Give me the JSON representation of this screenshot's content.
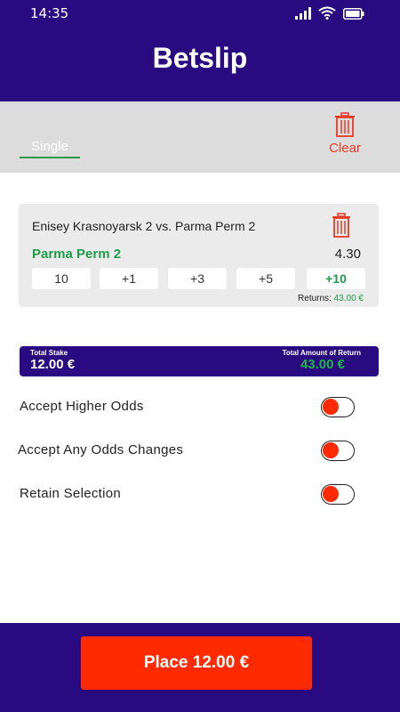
{
  "status_bar": {
    "time": "14:35",
    "icons": [
      "signal-icon",
      "wifi-icon",
      "battery-icon"
    ]
  },
  "header": {
    "title": "Betslip"
  },
  "tabs": {
    "single_label": "Single",
    "clear_label": "Clear"
  },
  "bet": {
    "match": "Enisey Krasnoyarsk 2 vs. Parma Perm 2",
    "selection": "Parma Perm 2",
    "odds": "4.30",
    "stake_buttons": [
      "10",
      "+1",
      "+3",
      "+5",
      "+10"
    ],
    "returns_label": "Returns:",
    "returns_value": "43.00 €"
  },
  "totals": {
    "stake_label": "Total Stake",
    "stake_value": "12.00 €",
    "return_label": "Total Amount of Return",
    "return_value": "43.00 €"
  },
  "toggles": [
    {
      "label": "Accept Higher Odds"
    },
    {
      "label": "Accept Any Odds Changes"
    },
    {
      "label": "Retain Selection"
    }
  ],
  "footer": {
    "place_label": "Place 12.00 €"
  },
  "colors": {
    "primary": "#2a0a80",
    "accent": "#ff2a00",
    "green": "#1f9d4a",
    "clear_red": "#e63b24"
  }
}
